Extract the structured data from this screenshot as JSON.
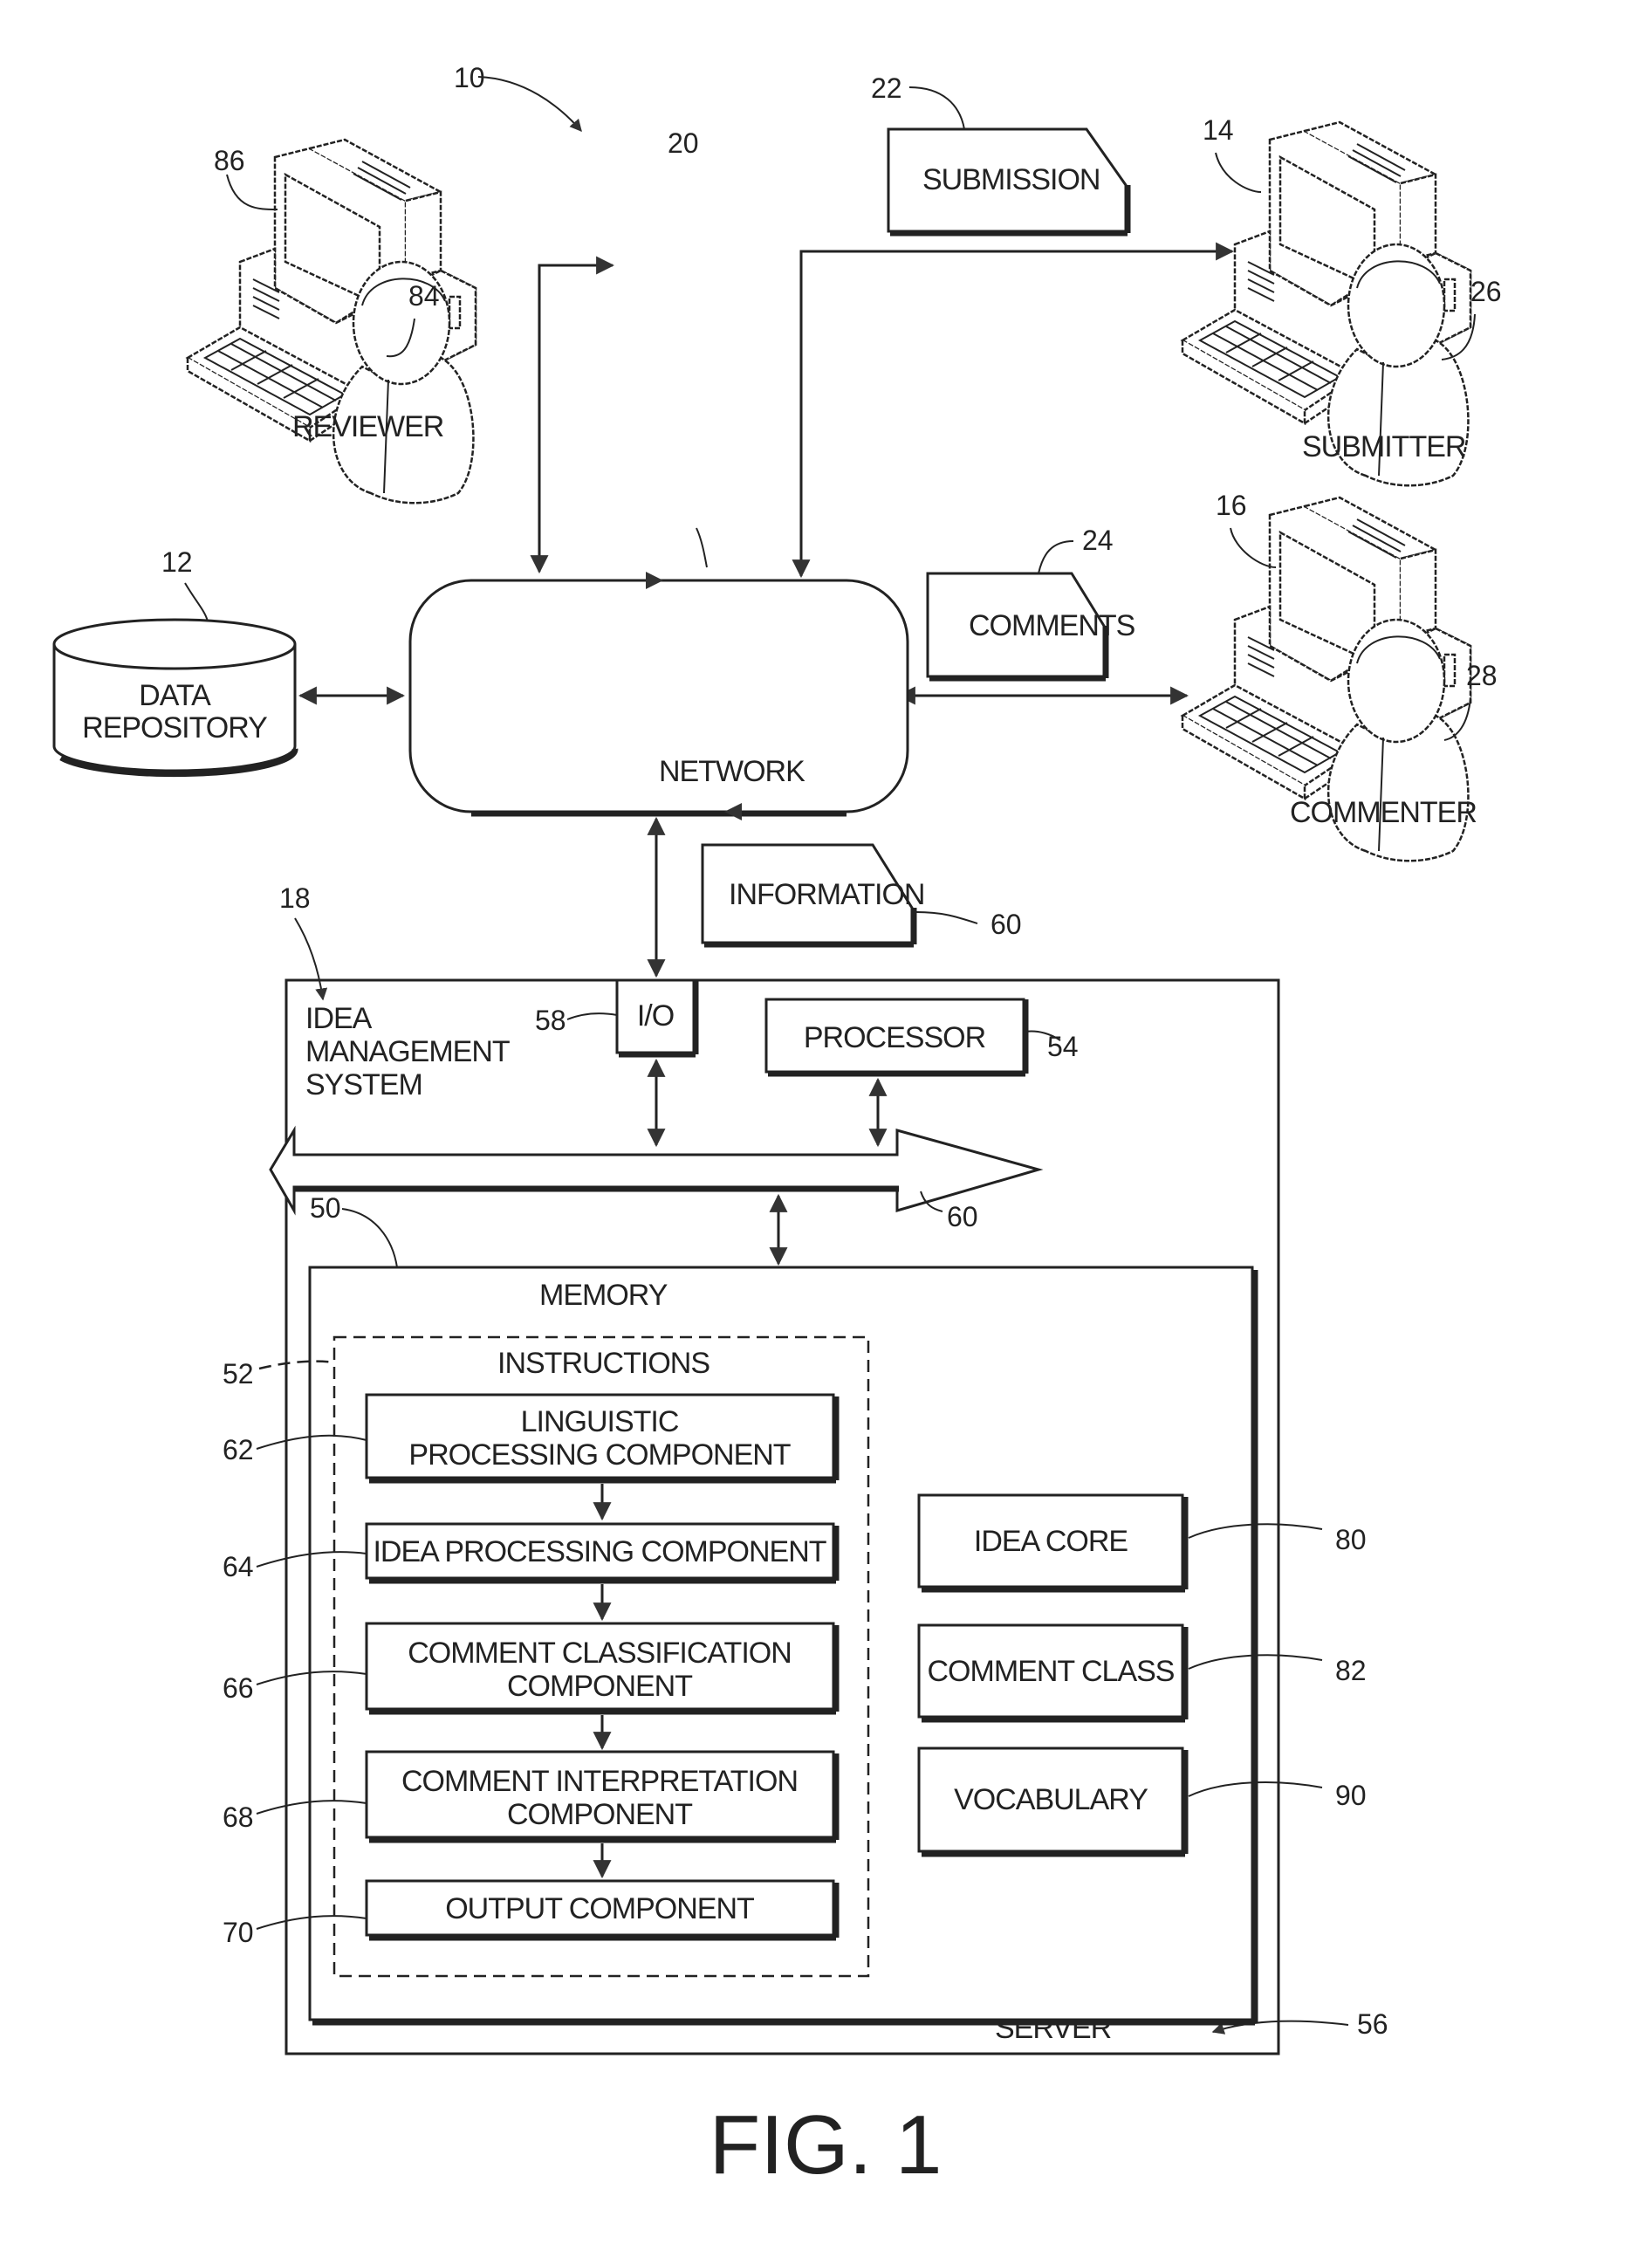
{
  "figure": {
    "caption": "FIG. 1",
    "system_ref": "10"
  },
  "actors": {
    "reviewer": {
      "label": "REVIEWER",
      "computer_ref": "86",
      "person_ref": "84"
    },
    "submitter": {
      "label": "SUBMITTER",
      "computer_ref": "14",
      "person_ref": "26"
    },
    "commenter": {
      "label": "COMMENTER",
      "computer_ref": "16",
      "person_ref": "28"
    }
  },
  "documents": {
    "submission": {
      "label": "SUBMISSION",
      "ref": "22"
    },
    "comments": {
      "label": "COMMENTS",
      "ref": "24"
    },
    "information": {
      "label": "INFORMATION",
      "ref": "60"
    }
  },
  "network": {
    "label": "NETWORK",
    "ref": "20"
  },
  "data_repository": {
    "label_line1": "DATA",
    "label_line2": "REPOSITORY",
    "ref": "12"
  },
  "idea_management_system": {
    "label_line1": "IDEA",
    "label_line2": "MANAGEMENT",
    "label_line3": "SYSTEM",
    "ref": "18",
    "io": {
      "label": "I/O",
      "ref": "58"
    },
    "processor": {
      "label": "PROCESSOR",
      "ref": "54"
    },
    "bus": {
      "ref": "60"
    },
    "server": {
      "label": "SERVER",
      "ref": "56"
    },
    "memory": {
      "label": "MEMORY",
      "ref": "50",
      "instructions": {
        "label": "INSTRUCTIONS",
        "ref": "52",
        "components": [
          {
            "line1": "LINGUISTIC",
            "line2": "PROCESSING COMPONENT",
            "ref": "62"
          },
          {
            "line1": "IDEA  PROCESSING COMPONENT",
            "line2": "",
            "ref": "64"
          },
          {
            "line1": "COMMENT CLASSIFICATION",
            "line2": "COMPONENT",
            "ref": "66"
          },
          {
            "line1": "COMMENT INTERPRETATION",
            "line2": "COMPONENT",
            "ref": "68"
          },
          {
            "line1": "OUTPUT COMPONENT",
            "line2": "",
            "ref": "70"
          }
        ]
      },
      "data_stores": [
        {
          "label": "IDEA CORE",
          "ref": "80"
        },
        {
          "label": "COMMENT CLASS",
          "ref": "82"
        },
        {
          "label": "VOCABULARY",
          "ref": "90"
        }
      ]
    }
  }
}
